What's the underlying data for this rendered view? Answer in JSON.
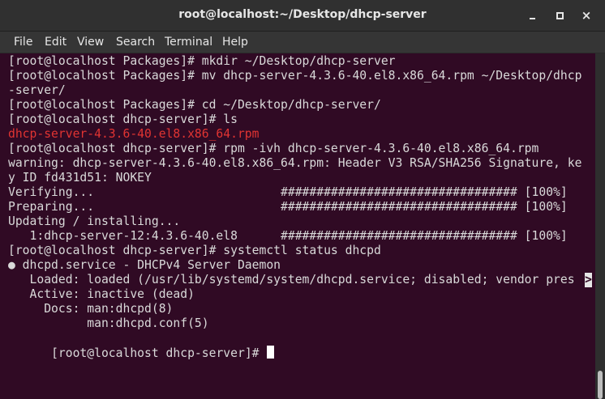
{
  "window": {
    "title": "root@localhost:~/Desktop/dhcp-server",
    "controls": {
      "minimize_icon": "minimize-icon",
      "maximize_icon": "maximize-icon",
      "close_icon": "close-icon"
    }
  },
  "menubar": {
    "items": [
      "File",
      "Edit",
      "View",
      "Search",
      "Terminal",
      "Help"
    ]
  },
  "terminal": {
    "accent_colors": {
      "background": "#300a24",
      "text": "#d9d9d9",
      "rpm_file": "#e13432"
    },
    "lines": [
      "[root@localhost Packages]# mkdir ~/Desktop/dhcp-server",
      "[root@localhost Packages]# mv dhcp-server-4.3.6-40.el8.x86_64.rpm ~/Desktop/dhcp",
      "-server/",
      "[root@localhost Packages]# cd ~/Desktop/dhcp-server/",
      "[root@localhost dhcp-server]# ls",
      "dhcp-server-4.3.6-40.el8.x86_64.rpm",
      "[root@localhost dhcp-server]# rpm -ivh dhcp-server-4.3.6-40.el8.x86_64.rpm",
      "warning: dhcp-server-4.3.6-40.el8.x86_64.rpm: Header V3 RSA/SHA256 Signature, ke",
      "y ID fd431d51: NOKEY",
      "Verifying...                          ################################# [100%]",
      "Preparing...                          ################################# [100%]",
      "Updating / installing...",
      "   1:dhcp-server-12:4.3.6-40.el8      ################################# [100%]",
      "[root@localhost dhcp-server]# systemctl status dhcpd",
      "● dhcpd.service - DHCPv4 Server Daemon",
      "   Loaded: loaded (/usr/lib/systemd/system/dhcpd.service; disabled; vendor pres",
      "   Active: inactive (dead)",
      "     Docs: man:dhcpd(8)",
      "           man:dhcpd.conf(5)",
      "[root@localhost dhcp-server]# "
    ],
    "truncation_marker": ">"
  }
}
